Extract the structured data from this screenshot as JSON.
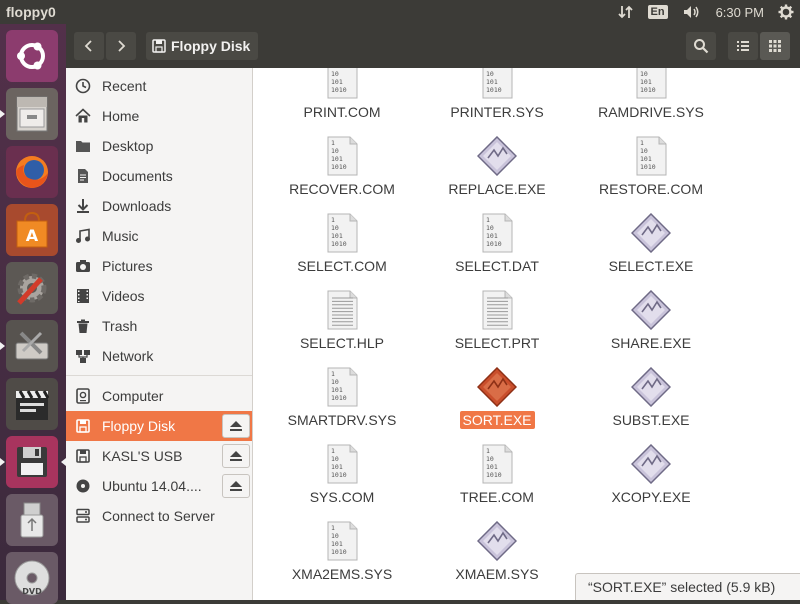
{
  "window": {
    "title": "floppy0"
  },
  "tray": {
    "keyboard": "En",
    "clock": "6:30 PM"
  },
  "launcher": [
    {
      "name": "ubuntu-dash",
      "icon": "ubuntu-logo-icon"
    },
    {
      "name": "files",
      "icon": "file-cabinet-icon"
    },
    {
      "name": "firefox",
      "icon": "firefox-icon"
    },
    {
      "name": "software-center",
      "icon": "shopping-bag-icon"
    },
    {
      "name": "system-settings",
      "icon": "settings-gear-icon"
    },
    {
      "name": "disk-utility",
      "icon": "hard-disk-tools-icon"
    },
    {
      "name": "video-editor",
      "icon": "clapperboard-icon"
    },
    {
      "name": "floppy-drive",
      "icon": "floppy-disk-icon"
    },
    {
      "name": "usb-drive",
      "icon": "usb-stick-icon"
    },
    {
      "name": "optical-drive",
      "icon": "dvd-icon"
    }
  ],
  "header": {
    "path_label": "Floppy Disk"
  },
  "sidebar": {
    "places": [
      {
        "label": "Recent",
        "icon": "clock-icon"
      },
      {
        "label": "Home",
        "icon": "home-icon"
      },
      {
        "label": "Desktop",
        "icon": "folder-icon"
      },
      {
        "label": "Documents",
        "icon": "document-icon"
      },
      {
        "label": "Downloads",
        "icon": "download-icon"
      },
      {
        "label": "Music",
        "icon": "music-icon"
      },
      {
        "label": "Pictures",
        "icon": "camera-icon"
      },
      {
        "label": "Videos",
        "icon": "film-icon"
      },
      {
        "label": "Trash",
        "icon": "trash-icon"
      },
      {
        "label": "Network",
        "icon": "network-icon"
      }
    ],
    "devices": [
      {
        "label": "Computer",
        "icon": "computer-icon",
        "eject": false
      },
      {
        "label": "Floppy Disk",
        "icon": "floppy-icon",
        "eject": true,
        "selected": true
      },
      {
        "label": "KASL'S USB",
        "icon": "drive-icon",
        "eject": true
      },
      {
        "label": "Ubuntu 14.04....",
        "icon": "disc-icon",
        "eject": true
      }
    ],
    "connect": {
      "label": "Connect to Server",
      "icon": "server-icon"
    }
  },
  "files": [
    {
      "name": "PRINT.COM",
      "type": "binary"
    },
    {
      "name": "PRINTER.SYS",
      "type": "binary"
    },
    {
      "name": "RAMDRIVE.SYS",
      "type": "binary"
    },
    {
      "name": "RECOVER.COM",
      "type": "binary"
    },
    {
      "name": "REPLACE.EXE",
      "type": "exe"
    },
    {
      "name": "RESTORE.COM",
      "type": "binary"
    },
    {
      "name": "SELECT.COM",
      "type": "binary"
    },
    {
      "name": "SELECT.DAT",
      "type": "binary"
    },
    {
      "name": "SELECT.EXE",
      "type": "exe"
    },
    {
      "name": "SELECT.HLP",
      "type": "text"
    },
    {
      "name": "SELECT.PRT",
      "type": "text"
    },
    {
      "name": "SHARE.EXE",
      "type": "exe"
    },
    {
      "name": "SMARTDRV.SYS",
      "type": "binary"
    },
    {
      "name": "SORT.EXE",
      "type": "exe",
      "selected": true
    },
    {
      "name": "SUBST.EXE",
      "type": "exe"
    },
    {
      "name": "SYS.COM",
      "type": "binary"
    },
    {
      "name": "TREE.COM",
      "type": "binary"
    },
    {
      "name": "XCOPY.EXE",
      "type": "exe"
    },
    {
      "name": "XMA2EMS.SYS",
      "type": "binary"
    },
    {
      "name": "XMAEM.SYS",
      "type": "exe"
    }
  ],
  "binary_icon_lines": [
    "1",
    "10",
    "101",
    "1010"
  ],
  "status": {
    "text": "“SORT.EXE” selected  (5.9 kB)"
  },
  "colors": {
    "accent": "#f07746",
    "panel": "#3c3b37",
    "sidebar": "#f5f4f3"
  }
}
